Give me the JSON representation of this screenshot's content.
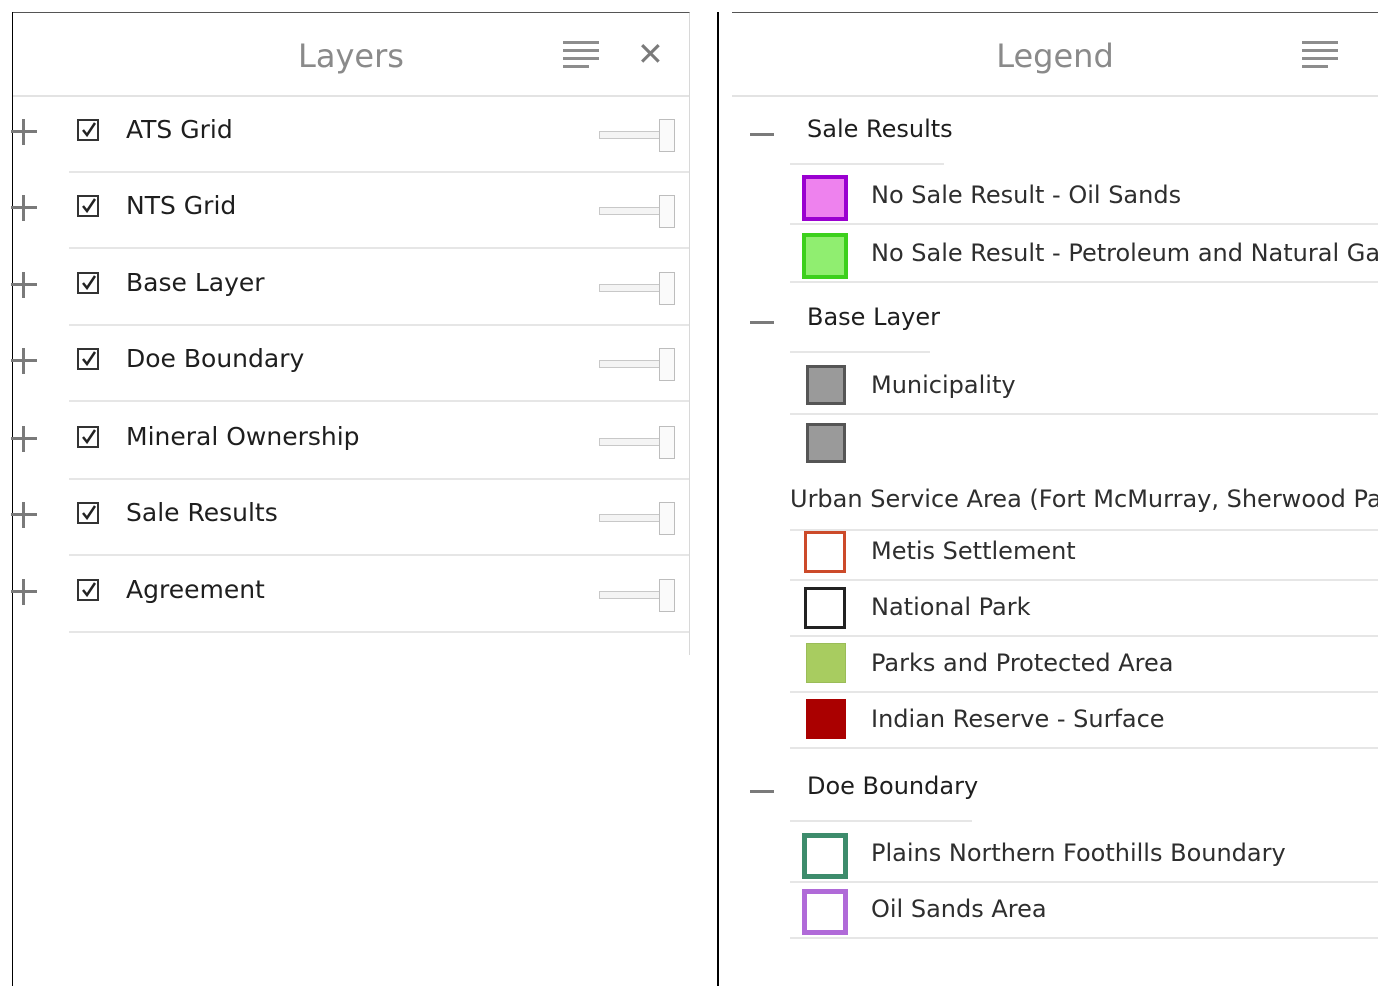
{
  "layers_panel": {
    "title": "Layers",
    "menu_icon": "hamburger-menu-icon",
    "close_symbol": "✕",
    "layers": [
      {
        "label": "ATS Grid",
        "checked": true
      },
      {
        "label": "NTS Grid",
        "checked": true
      },
      {
        "label": "Base Layer",
        "checked": true
      },
      {
        "label": "Doe Boundary",
        "checked": true
      },
      {
        "label": "Mineral Ownership",
        "checked": true
      },
      {
        "label": "Sale Results",
        "checked": true
      },
      {
        "label": "Agreement",
        "checked": true
      }
    ]
  },
  "legend_panel": {
    "title": "Legend",
    "menu_icon": "hamburger-menu-icon",
    "groups": [
      {
        "title": "Sale Results",
        "items": [
          {
            "label": "No Sale Result - Oil Sands",
            "fill": "#ee82ee",
            "border": "#9a00d0"
          },
          {
            "label": "No Sale Result - Petroleum and Natural Gas",
            "fill": "#90ee70",
            "border": "#3cd01c"
          }
        ]
      },
      {
        "title": "Base Layer",
        "items": [
          {
            "label": "Municipality",
            "fill": "#9a9a9a",
            "border": "#555555"
          },
          {
            "label": "Urban Service Area (Fort McMurray, Sherwood Park)",
            "fill": "#9a9a9a",
            "border": "#555555"
          },
          {
            "label": "Metis Settlement",
            "fill": "#ffffff",
            "border": "#cc4a2a"
          },
          {
            "label": "National Park",
            "fill": "#ffffff",
            "border": "#222222"
          },
          {
            "label": "Parks and Protected Area",
            "fill": "#a8cc60",
            "border": "#a8cc60"
          },
          {
            "label": "Indian Reserve - Surface",
            "fill": "#aa0000",
            "border": "#aa0000"
          }
        ]
      },
      {
        "title": "Doe Boundary",
        "items": [
          {
            "label": "Plains Northern Foothills Boundary",
            "fill": "#ffffff",
            "border": "#3d8c6c"
          },
          {
            "label": "Oil Sands Area",
            "fill": "#ffffff",
            "border": "#b06ad8"
          }
        ]
      }
    ]
  }
}
